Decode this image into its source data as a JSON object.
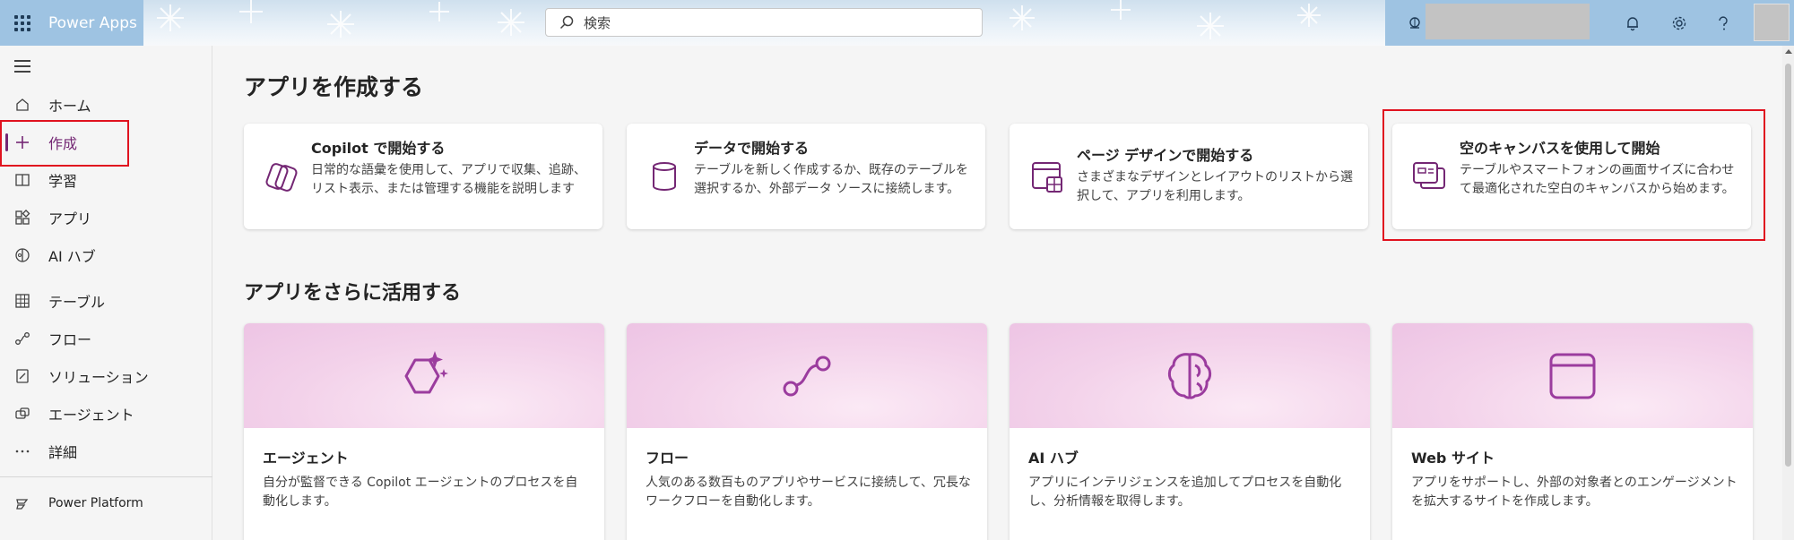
{
  "header": {
    "app_name": "Power Apps",
    "search_placeholder": "検索"
  },
  "sidebar": {
    "items": [
      {
        "label": "ホーム",
        "icon": "home-icon"
      },
      {
        "label": "作成",
        "icon": "plus-icon",
        "active": true
      },
      {
        "label": "学習",
        "icon": "book-icon"
      },
      {
        "label": "アプリ",
        "icon": "apps-icon"
      },
      {
        "label": "AI ハブ",
        "icon": "ai-hub-icon"
      },
      {
        "label": "テーブル",
        "icon": "table-icon"
      },
      {
        "label": "フロー",
        "icon": "flow-icon"
      },
      {
        "label": "ソリューション",
        "icon": "solution-icon"
      },
      {
        "label": "エージェント",
        "icon": "agent-icon"
      },
      {
        "label": "詳細",
        "icon": "more-icon"
      }
    ],
    "footer_label": "Power Platform"
  },
  "main": {
    "create_heading": "アプリを作成する",
    "start_cards": [
      {
        "title": "Copilot で開始する",
        "description": "日常的な語彙を使用して、アプリで収集、追跡、リスト表示、または管理する機能を説明します",
        "icon": "copilot-icon"
      },
      {
        "title": "データで開始する",
        "description": "テーブルを新しく作成するか、既存のテーブルを選択するか、外部データ ソースに接続します。",
        "icon": "database-icon"
      },
      {
        "title": "ページ デザインで開始する",
        "description": "さまざまなデザインとレイアウトのリストから選択して、アプリを利用します。",
        "icon": "page-design-icon"
      },
      {
        "title": "空のキャンバスを使用して開始",
        "description": "テーブルやスマートフォンの画面サイズに合わせて最適化された空白のキャンバスから始めます。",
        "icon": "blank-canvas-icon"
      }
    ],
    "more_heading": "アプリをさらに活用する",
    "feature_tiles": [
      {
        "title": "エージェント",
        "description": "自分が監督できる Copilot エージェントのプロセスを自動化します。",
        "icon": "agent-sparkle-icon"
      },
      {
        "title": "フロー",
        "description": "人気のある数百ものアプリやサービスに接続して、冗長なワークフローを自動化します。",
        "icon": "flow-icon"
      },
      {
        "title": "AI ハブ",
        "description": "アプリにインテリジェンスを追加してプロセスを自動化し、分析情報を取得します。",
        "icon": "brain-icon"
      },
      {
        "title": "Web サイト",
        "description": "アプリをサポートし、外部の対象者とのエンゲージメントを拡大するサイトを作成します。",
        "icon": "website-icon"
      }
    ]
  },
  "colors": {
    "accent": "#742774",
    "highlight_border": "#e0121f",
    "tile_band": "#f3d2ea"
  }
}
